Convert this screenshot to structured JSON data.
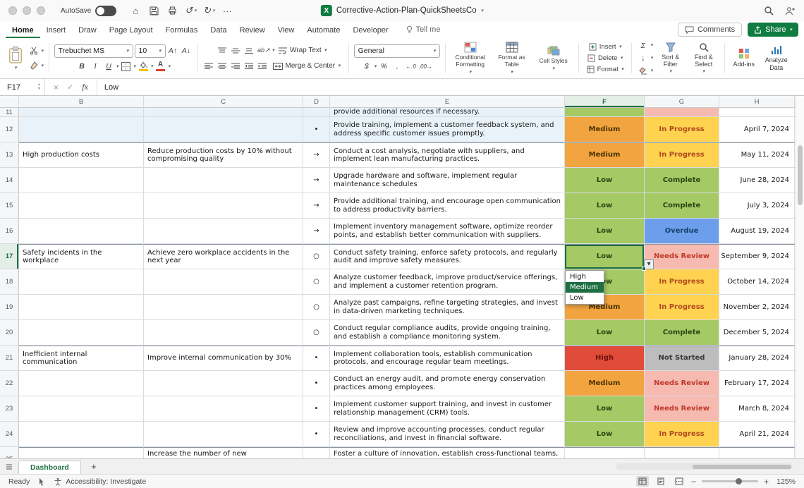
{
  "colors": {
    "selection": "#1d6f42",
    "excel-green": "#107c41",
    "fill-swatch": "#ffc000",
    "font-swatch": "#e03c31",
    "group-shade": "#e9f2f9",
    "prio-orange-bg": "#f2a440",
    "prio-orange-text": "#4c3300",
    "prio-green-bg": "#a5c964",
    "prio-green-text": "#2d4512",
    "prio-red-bg": "#e14b3a",
    "prio-red-text": "#6e120b",
    "stat-yellow-bg": "#ffd34f",
    "stat-yellow-text": "#b04a1f",
    "stat-green-bg": "#a5c964",
    "stat-green-text": "#2d4512",
    "stat-blue-bg": "#6d9eeb",
    "stat-blue-text": "#17406e",
    "stat-pink-bg": "#f6bab0",
    "stat-pink-text": "#bf3a2b",
    "stat-gray-bg": "#bdbdbd",
    "stat-gray-text": "#3a3a3a"
  },
  "icons": {
    "home": "⌂",
    "undo": "↺",
    "redo": "↻",
    "more": "···",
    "chevron-down": "▾",
    "dropdown-arrow": "▼",
    "spinner-up": "▲",
    "spinner-down": "▼",
    "cancel": "×",
    "enter": "✓",
    "bold": "B",
    "italic": "I",
    "underline": "U",
    "increase-font": "A↑",
    "decrease-font": "A↓",
    "autosum": "Σ",
    "fill-down": "↓",
    "currency": "$",
    "percent": "%",
    "comma": ",",
    "increase-decimal": "←.0",
    "decrease-decimal": ".00→",
    "orientation": "ab↗",
    "add": "+",
    "zoom-out": "−",
    "zoom-in": "+"
  },
  "titlebar": {
    "autosave_label": "AutoSave",
    "doc_title": "Corrective-Action-Plan-QuickSheetsCo"
  },
  "tab_row": {
    "tabs": [
      "Home",
      "Insert",
      "Draw",
      "Page Layout",
      "Formulas",
      "Data",
      "Review",
      "View",
      "Automate",
      "Developer"
    ],
    "active_tab": "Home",
    "tell_me": "Tell me",
    "comments_label": "Comments",
    "share_label": "Share"
  },
  "ribbon": {
    "font_name": "Trebuchet MS",
    "font_size": "10",
    "wrap_text_label": "Wrap Text",
    "merge_center_label": "Merge & Center",
    "number_format": "General",
    "conditional_formatting_label": "Conditional Formatting",
    "format_as_table_label": "Format as Table",
    "cell_styles_label": "Cell Styles",
    "insert_label": "Insert",
    "delete_label": "Delete",
    "format_label": "Format",
    "sort_filter_label": "Sort & Filter",
    "find_select_label": "Find & Select",
    "addins_label": "Add-ins",
    "analyze_data_label": "Analyze Data"
  },
  "formula_bar": {
    "name_box": "F17",
    "fx_label": "fx",
    "value": "Low"
  },
  "grid": {
    "columns": [
      "B",
      "C",
      "D",
      "E",
      "F",
      "G",
      "H"
    ],
    "selected_column": "F",
    "bullet_glyphs": {
      "dot": "•",
      "arrow": "→",
      "circle": "○"
    },
    "rows": [
      {
        "n": "11",
        "partial": "top",
        "shaded": true,
        "b": "",
        "c": "",
        "bullet": "",
        "e": "provide additional resources if necessary.",
        "priority": {
          "label": "",
          "color": "green"
        },
        "status": {
          "label": "",
          "color": "pink"
        },
        "date": ""
      },
      {
        "n": "12",
        "shaded": true,
        "b": "",
        "c": "",
        "bullet": "dot",
        "e": "Provide training, implement a customer feedback system, and address specific customer issues promptly.",
        "priority": {
          "label": "Medium",
          "color": "orange"
        },
        "status": {
          "label": "In Progress",
          "color": "yellow"
        },
        "date": "April 7, 2024"
      },
      {
        "n": "13",
        "group_start": true,
        "b": "High production costs",
        "c": "Reduce production costs by 10% without compromising quality",
        "bullet": "arrow",
        "e": "Conduct a cost analysis, negotiate with suppliers, and implement lean manufacturing practices.",
        "priority": {
          "label": "Medium",
          "color": "orange"
        },
        "status": {
          "label": "In Progress",
          "color": "yellow"
        },
        "date": "May 11, 2024"
      },
      {
        "n": "14",
        "b": "",
        "c": "",
        "bullet": "arrow",
        "e": "Upgrade hardware and software, implement regular maintenance schedules",
        "priority": {
          "label": "Low",
          "color": "green"
        },
        "status": {
          "label": "Complete",
          "color": "green"
        },
        "date": "June 28, 2024"
      },
      {
        "n": "15",
        "b": "",
        "c": "",
        "bullet": "arrow",
        "e": "Provide additional training, and encourage open communication to address productivity barriers.",
        "priority": {
          "label": "Low",
          "color": "green"
        },
        "status": {
          "label": "Complete",
          "color": "green"
        },
        "date": "July 3, 2024"
      },
      {
        "n": "16",
        "b": "",
        "c": "",
        "bullet": "arrow",
        "e": "Implement inventory management software, optimize reorder points, and establish better communication with suppliers.",
        "priority": {
          "label": "Low",
          "color": "green"
        },
        "status": {
          "label": "Overdue",
          "color": "blue"
        },
        "date": "August 19, 2024"
      },
      {
        "n": "17",
        "group_start": true,
        "selected": true,
        "b": "Safety incidents in the workplace",
        "c": "Achieve zero workplace accidents in the next year",
        "bullet": "circle",
        "e": "Conduct safety training, enforce safety protocols, and regularly audit and improve safety measures.",
        "priority": {
          "label": "Low",
          "color": "green"
        },
        "status": {
          "label": "Needs Review",
          "color": "pink"
        },
        "date": "September 9, 2024"
      },
      {
        "n": "18",
        "b": "",
        "c": "",
        "bullet": "circle",
        "e": "Analyze customer feedback, improve product/service offerings, and implement a customer retention program.",
        "priority": {
          "label": "Low",
          "color": "green"
        },
        "status": {
          "label": "In Progress",
          "color": "yellow"
        },
        "date": "October 14, 2024"
      },
      {
        "n": "19",
        "b": "",
        "c": "",
        "bullet": "circle",
        "e": "Analyze past campaigns, refine targeting strategies, and invest in data-driven marketing techniques.",
        "priority": {
          "label": "Medium",
          "color": "orange"
        },
        "status": {
          "label": "In Progress",
          "color": "yellow"
        },
        "date": "November 2, 2024"
      },
      {
        "n": "20",
        "b": "",
        "c": "",
        "bullet": "circle",
        "e": "Conduct regular compliance audits, provide ongoing training, and establish a compliance monitoring system.",
        "priority": {
          "label": "Low",
          "color": "green"
        },
        "status": {
          "label": "Complete",
          "color": "green"
        },
        "date": "December 5, 2024"
      },
      {
        "n": "21",
        "group_start": true,
        "b": "Inefficient internal communication",
        "c": "Improve internal communication by 30%",
        "bullet": "dot",
        "e": "Implement collaboration tools, establish communication protocols, and encourage regular team meetings.",
        "priority": {
          "label": "High",
          "color": "red"
        },
        "status": {
          "label": "Not Started",
          "color": "gray"
        },
        "date": "January 28, 2024"
      },
      {
        "n": "22",
        "b": "",
        "c": "",
        "bullet": "dot",
        "e": "Conduct an energy audit, and promote energy conservation practices among employees.",
        "priority": {
          "label": "Medium",
          "color": "orange"
        },
        "status": {
          "label": "Needs Review",
          "color": "pink"
        },
        "date": "February 17, 2024"
      },
      {
        "n": "23",
        "b": "",
        "c": "",
        "bullet": "dot",
        "e": "Implement customer support training, and invest in customer relationship management (CRM) tools.",
        "priority": {
          "label": "Low",
          "color": "green"
        },
        "status": {
          "label": "Needs Review",
          "color": "pink"
        },
        "date": "March 8, 2024"
      },
      {
        "n": "24",
        "b": "",
        "c": "",
        "bullet": "dot",
        "e": "Review and improve accounting processes, conduct regular reconciliations, and invest in financial software.",
        "priority": {
          "label": "Low",
          "color": "green"
        },
        "status": {
          "label": "In Progress",
          "color": "yellow"
        },
        "date": "April 21, 2024"
      },
      {
        "n": "25",
        "partial": "bottom",
        "group_start": true,
        "b": "",
        "c": "Increase the number of new product/service",
        "bullet": "",
        "e": "Foster a culture of innovation, establish cross-functional teams, and",
        "priority": {
          "label": "",
          "color": "none"
        },
        "status": {
          "label": "",
          "color": "none"
        },
        "date": ""
      }
    ]
  },
  "validation_dropdown": {
    "options": [
      "High",
      "Medium",
      "Low"
    ],
    "highlighted": "Medium"
  },
  "sheet_tabs": {
    "active": "Dashboard"
  },
  "status_bar": {
    "ready": "Ready",
    "accessibility": "Accessibility: Investigate",
    "zoom_level": "125%"
  }
}
